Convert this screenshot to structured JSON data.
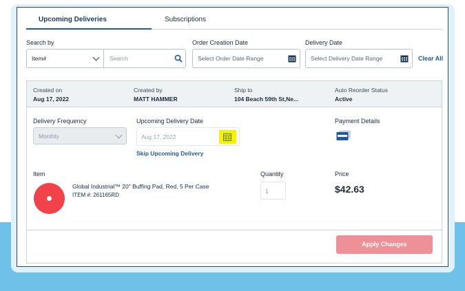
{
  "tabs": [
    {
      "label": "Upcoming Deliveries",
      "active": true
    },
    {
      "label": "Subscriptions",
      "active": false
    }
  ],
  "filters": {
    "search_by_label": "Search by",
    "search_type_value": "Item#",
    "search_placeholder": "Search",
    "order_creation_label": "Order Creation Date",
    "order_date_placeholder": "Select Order Date Range",
    "delivery_date_label": "Delivery Date",
    "delivery_date_placeholder": "Select Delivery Date Range",
    "clear_all_label": "Clear All"
  },
  "subscription": {
    "header": {
      "created_on_label": "Created on",
      "created_on_value": "Aug 17, 2022",
      "created_by_label": "Created by",
      "created_by_value": "MATT HAMMER",
      "ship_to_label": "Ship to",
      "ship_to_value": "104 Beach 59th St,Ne...",
      "status_label": "Auto Reorder Status",
      "status_value": "Active"
    },
    "delivery_frequency_label": "Delivery Frequency",
    "delivery_frequency_value": "Monthly",
    "upcoming_date_label": "Upcoming Delivery Date",
    "upcoming_date_value": "Aug 17, 2022",
    "skip_label": "Skip Upcoming Delivery",
    "payment_label": "Payment Details",
    "item_col_label": "Item",
    "quantity_col_label": "Quantity",
    "price_col_label": "Price",
    "item": {
      "name": "Global Industrial™ 20\" Buffing Pad, Red, 5 Per Case",
      "number": "ITEM #: 261165RD",
      "quantity": "1",
      "price": "$42.63"
    },
    "apply_label": "Apply Changes"
  },
  "icons": [
    "search-icon",
    "calendar-icon",
    "chevron-down-icon",
    "credit-card-icon"
  ],
  "colors": {
    "accent": "#1f5aa0",
    "apply_button": "#ee9098",
    "highlight": "#f6f200",
    "background_band": "#6fc1ea"
  }
}
